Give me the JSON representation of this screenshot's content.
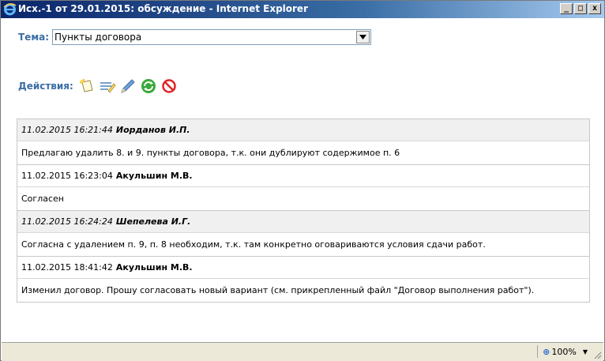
{
  "window": {
    "title": "Исх.-1 от 29.01.2015: обсуждение - Internet Explorer",
    "minimize_glyph": "_",
    "maximize_glyph": "□",
    "close_glyph": "x"
  },
  "topic": {
    "label": "Тема:",
    "value": "Пункты договора"
  },
  "actions": {
    "label": "Действия:",
    "icons": [
      "new-message-icon",
      "edit-text-icon",
      "pencil-icon",
      "refresh-icon",
      "cancel-icon"
    ]
  },
  "messages": [
    {
      "timestamp": "11.02.2015 16:21:44",
      "author": "Иорданов И.П.",
      "text": "Предлагаю удалить 8. и 9. пункты договора, т.к. они дублируют содержимое п. 6",
      "shaded": true
    },
    {
      "timestamp": "11.02.2015 16:23:04",
      "author": "Акульшин М.В.",
      "text": "Согласен",
      "shaded": false
    },
    {
      "timestamp": "11.02.2015 16:24:24",
      "author": "Шепелева И.Г.",
      "text": "Согласна с удалением п. 9, п. 8 необходим, т.к. там конкретно оговариваются условия сдачи работ.",
      "shaded": true
    },
    {
      "timestamp": "11.02.2015 18:41:42",
      "author": "Акульшин М.В.",
      "text": "Изменил договор. Прошу согласовать новый вариант (см. прикрепленный файл \"Договор выполнения работ\").",
      "shaded": false
    }
  ],
  "statusbar": {
    "zoom": "100%"
  },
  "colors": {
    "label_blue": "#3b6ea5",
    "title_gradient_start": "#0a246a",
    "shaded_row": "#f0f0f0"
  }
}
